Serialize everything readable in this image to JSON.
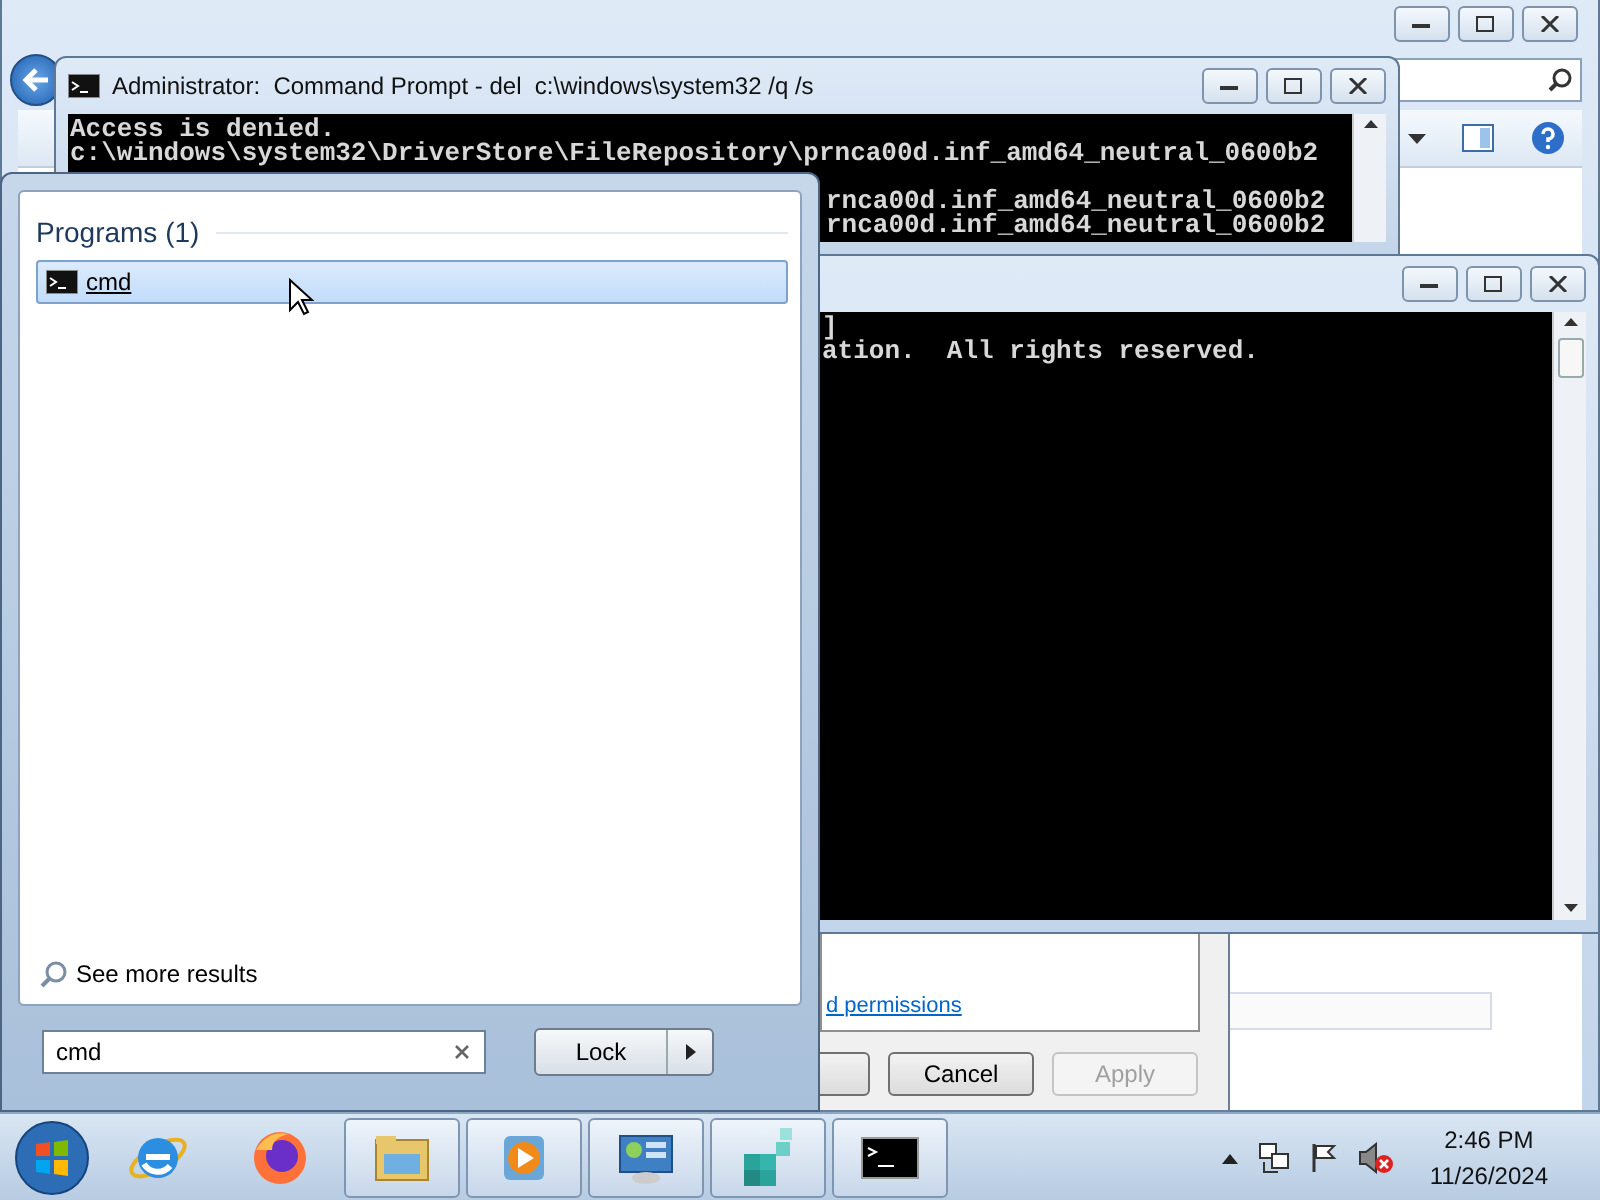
{
  "admin_console": {
    "title": "Administrator:  Command Prompt - del  c:\\windows\\system32 /q /s",
    "lines": [
      {
        "text": "Access is denied.",
        "kind": "full"
      },
      {
        "text": "c:\\windows\\system32\\DriverStore\\FileRepository\\prnca00d.inf_amd64_neutral_0600b2",
        "kind": "full"
      },
      {
        "kind": "hidden"
      },
      {
        "text": "rnca00d.inf_amd64_neutral_0600b2",
        "kind": "partial"
      },
      {
        "text": "rnca00d.inf_amd64_neutral_0600b2",
        "kind": "partial"
      }
    ]
  },
  "console": {
    "lines": [
      "]",
      "ation.  All rights reserved."
    ]
  },
  "properties_dialog": {
    "link": "d permissions",
    "buttons": [
      {
        "label": "Cancel",
        "disabled": false
      },
      {
        "label": "Apply",
        "disabled": true
      }
    ]
  },
  "start_menu": {
    "section": "Programs (1)",
    "results": [
      {
        "label": "cmd",
        "selected": true
      }
    ],
    "see_more": "See more results",
    "search": {
      "value": "cmd"
    },
    "power_button": "Lock"
  },
  "taskbar": {
    "items": [
      {
        "kind": "ie",
        "running": false
      },
      {
        "kind": "firefox",
        "running": false
      },
      {
        "kind": "explorer",
        "running": true
      },
      {
        "kind": "media",
        "running": true
      },
      {
        "kind": "control",
        "running": true
      },
      {
        "kind": "registry",
        "running": true
      },
      {
        "kind": "console",
        "running": true
      }
    ],
    "tray_icons": [
      {
        "kind": "chevron"
      },
      {
        "kind": "network"
      },
      {
        "kind": "flag"
      },
      {
        "kind": "speaker-muted"
      }
    ],
    "clock": {
      "time": "2:46 PM",
      "date": "11/26/2024"
    }
  }
}
